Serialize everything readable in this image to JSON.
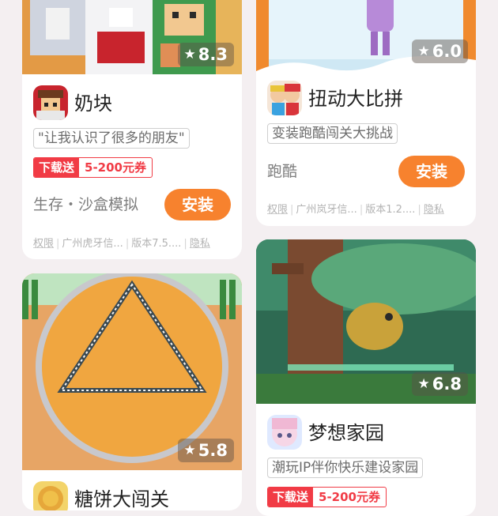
{
  "cards": [
    {
      "rating": "8.3",
      "app_name": "奶块",
      "tag": "\"让我认识了很多的朋友\"",
      "promo": {
        "label": "下载送",
        "value": "5-200元券"
      },
      "category": "生存・沙盒模拟",
      "install_label": "安装",
      "meta": {
        "permissions": "权限",
        "developer": "广州虎牙信...",
        "version": "版本7.5....",
        "privacy": "隐私"
      }
    },
    {
      "rating": "6.0",
      "app_name": "扭动大比拼",
      "tag": "变装跑酷闯关大挑战",
      "category": "跑酷",
      "install_label": "安装",
      "meta": {
        "permissions": "权限",
        "developer": "广州岚牙信...",
        "version": "版本1.2....",
        "privacy": "隐私"
      }
    },
    {
      "rating": "5.8",
      "app_name": "糖饼大闯关"
    },
    {
      "rating": "6.8",
      "app_name": "梦想家园",
      "tag": "潮玩IP伴你快乐建设家园",
      "promo": {
        "label": "下载送",
        "value": "5-200元券"
      }
    }
  ],
  "icons": {
    "rating": "star-icon"
  },
  "colors": {
    "install": "#f7822e",
    "promo": "#f13b45",
    "background": "#f4eff1"
  }
}
